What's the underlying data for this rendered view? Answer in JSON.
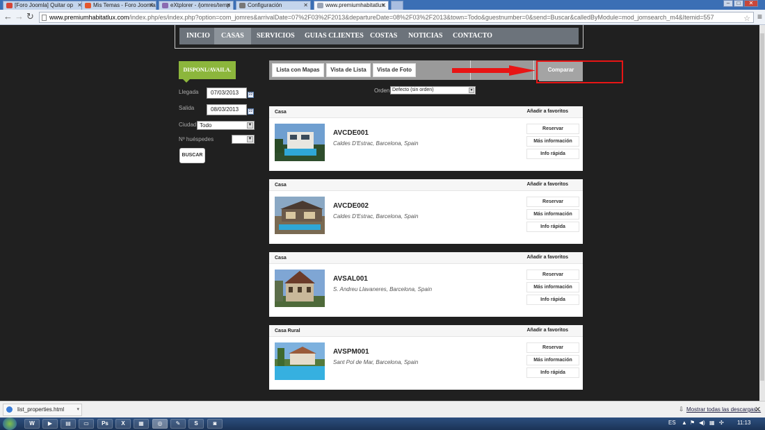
{
  "browser": {
    "tabs": [
      {
        "label": "[Foro Joomla] Quitar op",
        "icon_color": "#d44638",
        "active": false
      },
      {
        "label": "Mis Temas - Foro Joomla",
        "icon_color": "#e4572e",
        "active": false
      },
      {
        "label": "eXtplorer - /jomres/temp",
        "icon_color": "#8a6bb1",
        "active": false
      },
      {
        "label": "Configuración",
        "icon_color": "#777777",
        "active": false
      },
      {
        "label": "www.premiumhabitatlux.",
        "icon_color": "#9aa4b5",
        "active": true
      }
    ],
    "url_host": "www.premiumhabitatlux.com",
    "url_path": "/index.php/es/index.php?option=com_jomres&arrivalDate=07%2F03%2F2013&departureDate=08%2F03%2F2013&town=Todo&guestnumber=0&send=Buscar&calledByModule=mod_jomsearch_m4&Itemid=557",
    "icons": [
      "back-icon",
      "forward-icon",
      "reload-icon",
      "star-icon",
      "menu-icon"
    ]
  },
  "nav": {
    "items": [
      "INICIO",
      "CASAS",
      "SERVICIOS",
      "GUIAS CLIENTES",
      "COSTAS",
      "NOTICIAS",
      "CONTACTO"
    ],
    "active": "CASAS"
  },
  "search": {
    "tag": "DISPONI./AVAILA.",
    "arrival_label": "Llegada",
    "arrival_value": "07/03/2013",
    "departure_label": "Salida",
    "departure_value": "08/03/2013",
    "city_label": "Ciudad",
    "city_value": "Todo",
    "guests_label": "Nº huéspedes",
    "guests_value": "",
    "button": "BUSCAR"
  },
  "toolbar": {
    "map_list": "Lista con Mapas",
    "list_view": "Vista de Lista",
    "photo_view": "Vista de Foto",
    "compare": "Comparar"
  },
  "order": {
    "label": "Orden",
    "value": "Defecto (sin orden)"
  },
  "properties": [
    {
      "type": "Casa",
      "fav": "Añadir a favoritos",
      "title": "AVCDE001",
      "location": "Caldes D'Estrac, Barcelona, Spain",
      "book": "Reservar",
      "more": "Más información",
      "quick": "Info rápida"
    },
    {
      "type": "Casa",
      "fav": "Añadir a favoritos",
      "title": "AVCDE002",
      "location": "Caldes D'Estrac, Barcelona, Spain",
      "book": "Reservar",
      "more": "Más información",
      "quick": "Info rápida"
    },
    {
      "type": "Casa",
      "fav": "Añadir a favoritos",
      "title": "AVSAL001",
      "location": "S. Andreu Llavaneres, Barcelona, Spain",
      "book": "Reservar",
      "more": "Más información",
      "quick": "Info rápida"
    },
    {
      "type": "Casa Rural",
      "fav": "Añadir a favoritos",
      "title": "AVSPM001",
      "location": "Sant Pol de Mar, Barcelona, Spain",
      "book": "Reservar",
      "more": "Más información",
      "quick": "Info rápida"
    }
  ],
  "downloads": {
    "file": "list_properties.html",
    "show_all": "Mostrar todas las descargas..."
  },
  "taskbar": {
    "apps": [
      "W",
      "▶",
      "▤",
      "▭",
      "Ps",
      "X",
      "▦",
      "◎",
      "✎",
      "S",
      "◙"
    ],
    "lang": "ES",
    "time": "11:13"
  },
  "colors": {
    "accent_green": "#8cb63c",
    "nav_bg": "#6c737b",
    "annotation_red": "#e81515"
  }
}
